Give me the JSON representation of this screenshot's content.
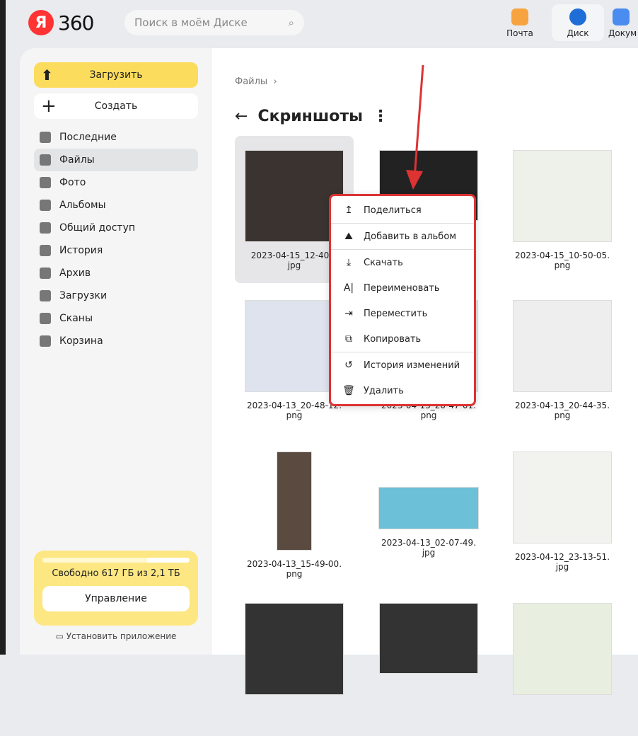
{
  "header": {
    "logo_letter": "Я",
    "logo_number": "360",
    "search_placeholder": "Поиск в моём Диске",
    "apps": [
      {
        "label": "Почта",
        "color": "#f7a440"
      },
      {
        "label": "Диск",
        "color": "#1f6ed8"
      },
      {
        "label": "Докум",
        "color": "#4a8cf0"
      }
    ]
  },
  "sidebar": {
    "upload": "Загрузить",
    "create": "Создать",
    "nav": [
      "Последние",
      "Файлы",
      "Фото",
      "Альбомы",
      "Общий доступ",
      "История",
      "Архив",
      "Загрузки",
      "Сканы",
      "Корзина"
    ],
    "active_index": 1,
    "storage": {
      "text": "Свободно 617 ГБ из 2,1 ТБ",
      "used_fraction": 0.71,
      "manage": "Управление"
    },
    "install": "Установить приложение"
  },
  "main": {
    "breadcrumb": "Файлы",
    "title": "Скриншоты",
    "files": [
      {
        "name": "2023-04-15_12-40-2",
        "ext": "jpg",
        "color": "#3a3330"
      },
      {
        "name": "",
        "ext": "",
        "color": "#222"
      },
      {
        "name": "2023-04-15_10-50-05.",
        "ext": "png",
        "color": "#eef0ea"
      },
      {
        "name": "2023-04-13_20-48-12.",
        "ext": "png",
        "color": "#dfe3ee"
      },
      {
        "name": "2023-04-13_20-47-01.",
        "ext": "png",
        "color": "#e6e6e6"
      },
      {
        "name": "2023-04-13_20-44-35.",
        "ext": "png",
        "color": "#eeeeee"
      },
      {
        "name": "2023-04-13_15-49-00.",
        "ext": "png",
        "color": "#5a4a40"
      },
      {
        "name": "2023-04-13_02-07-49.",
        "ext": "jpg",
        "color": "#6cc0d8"
      },
      {
        "name": "2023-04-12_23-13-51.",
        "ext": "jpg",
        "color": "#f2f2ee"
      },
      {
        "name": "",
        "ext": "",
        "color": "#333"
      },
      {
        "name": "",
        "ext": "",
        "color": "#333"
      },
      {
        "name": "",
        "ext": "",
        "color": "#e8efe0"
      }
    ]
  },
  "context_menu": {
    "items": [
      {
        "label": "Поделиться",
        "icon": "↥"
      },
      {
        "label": "Добавить в альбом",
        "icon": "⛰"
      },
      {
        "label": "Скачать",
        "icon": "⤓"
      },
      {
        "label": "Переименовать",
        "icon": "A|"
      },
      {
        "label": "Переместить",
        "icon": "⇥"
      },
      {
        "label": "Копировать",
        "icon": "⧉"
      },
      {
        "label": "История изменений",
        "icon": "↺"
      },
      {
        "label": "Удалить",
        "icon": "🗑"
      }
    ]
  }
}
